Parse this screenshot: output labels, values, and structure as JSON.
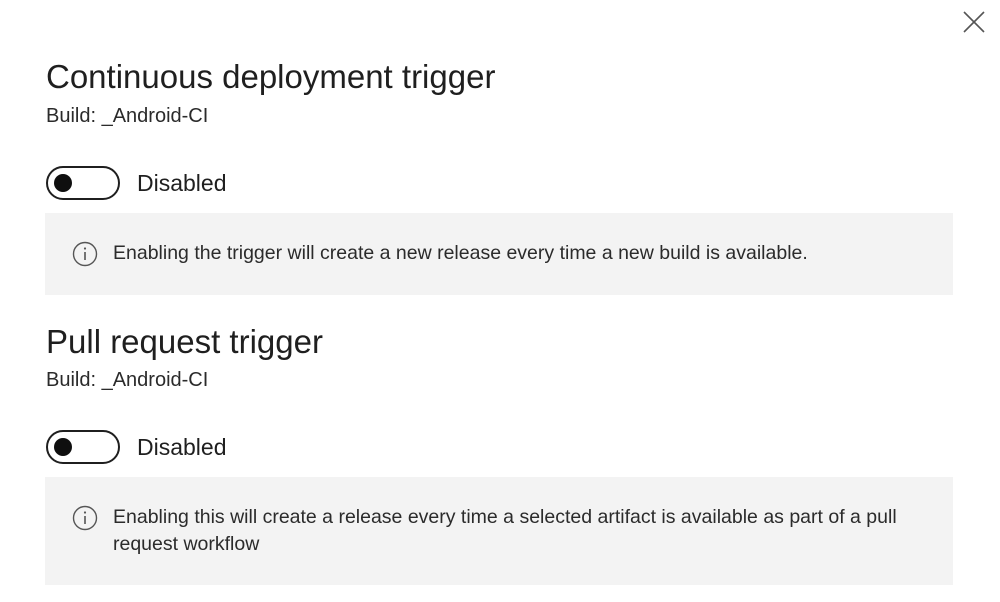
{
  "sections": [
    {
      "title": "Continuous deployment trigger",
      "build": "Build: _Android-CI",
      "toggle_label": "Disabled",
      "toggle_on": false,
      "info": "Enabling the trigger will create a new release every time a new build is available."
    },
    {
      "title": "Pull request trigger",
      "build": "Build: _Android-CI",
      "toggle_label": "Disabled",
      "toggle_on": false,
      "info": "Enabling this will create a release every time a selected artifact is available as part of a pull request workflow"
    }
  ],
  "icons": {
    "close": "close-icon",
    "info": "info-icon"
  },
  "colors": {
    "background": "#ffffff",
    "info_background": "#f3f3f3",
    "text": "#1f1f1f"
  }
}
